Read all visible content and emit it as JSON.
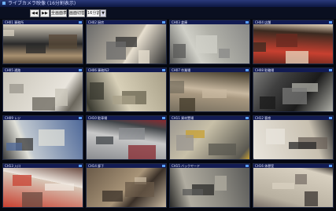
{
  "window": {
    "title": "ライブカメラ映像 (16分割表示)"
  },
  "toolbar": {
    "buttons": [
      {
        "label": "◀◀"
      },
      {
        "label": "▶▶"
      },
      {
        "label": "全画面表示"
      },
      {
        "label": "画面切替"
      }
    ],
    "selected_option": "16分割"
  },
  "cameras": [
    {
      "label": "CH01 事務所",
      "palette": [
        "#5a4a38",
        "#a89070",
        "#d8d0c0",
        "#2a2a2a"
      ]
    },
    {
      "label": "CH02 厨房",
      "palette": [
        "#6a6a6a",
        "#c0b8a8",
        "#303030",
        "#e8e0d0"
      ]
    },
    {
      "label": "CH03 倉庫",
      "palette": [
        "#8a8a88",
        "#b0b0a8",
        "#5a5a58",
        "#d0d0c8"
      ]
    },
    {
      "label": "CH04 店舗",
      "palette": [
        "#6a2a20",
        "#c84030",
        "#e8d8c0",
        "#3a2a20"
      ]
    },
    {
      "label": "CH05 通路",
      "palette": [
        "#c8c4b8",
        "#e8e4dc",
        "#9a968c",
        "#6a665c"
      ]
    },
    {
      "label": "CH06 事務所2",
      "palette": [
        "#a8a088",
        "#d8d0b8",
        "#6a6450",
        "#3a3a30"
      ]
    },
    {
      "label": "CH07 作業場",
      "palette": [
        "#787060",
        "#a89880",
        "#403828",
        "#c8b8a0"
      ]
    },
    {
      "label": "CH08 駐輪場",
      "palette": [
        "#7a7a78",
        "#404040",
        "#b0b0a8",
        "#1a1a1a"
      ]
    },
    {
      "label": "CH09 レジ",
      "palette": [
        "#506a9a",
        "#c0c8d0",
        "#3a3a3a",
        "#e0e0d8"
      ]
    },
    {
      "label": "CH10 駐車場",
      "palette": [
        "#8a8c90",
        "#c8c8c8",
        "#8a2a30",
        "#404448"
      ]
    },
    {
      "label": "CH11 資材置場",
      "palette": [
        "#9a9690",
        "#c8c0a8",
        "#c8a030",
        "#5a5850"
      ]
    },
    {
      "label": "CH12 客席",
      "palette": [
        "#2a2a2a",
        "#c8c0b0",
        "#6a6058",
        "#e8e4dc"
      ]
    },
    {
      "label": "CH13 入口",
      "palette": [
        "#c84030",
        "#d8c8b8",
        "#6a4a40",
        "#f0e8e0"
      ]
    },
    {
      "label": "CH14 廊下",
      "palette": [
        "#6a5a48",
        "#a89478",
        "#c8b8a0",
        "#3a3028"
      ]
    },
    {
      "label": "CH15 バックヤード",
      "palette": [
        "#5a5a58",
        "#8a8880",
        "#2a2a28",
        "#b0aca0"
      ]
    },
    {
      "label": "CH16 休憩室",
      "palette": [
        "#7a7068",
        "#b8b0a0",
        "#3a3430",
        "#d8d0c0"
      ]
    }
  ]
}
